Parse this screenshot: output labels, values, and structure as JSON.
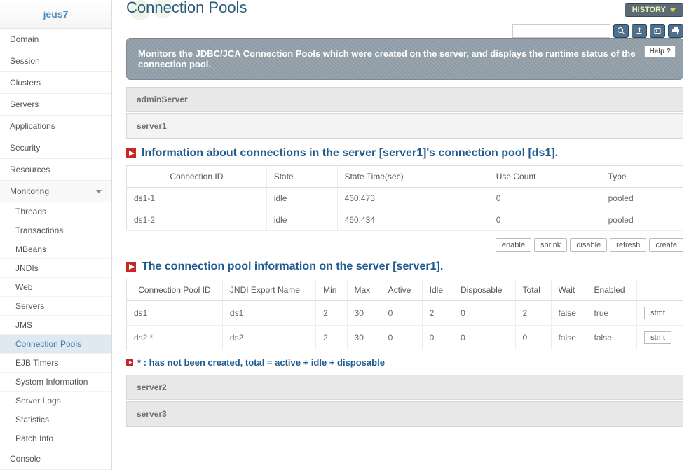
{
  "brand": "jeus7",
  "nav": {
    "items": [
      "Domain",
      "Session",
      "Clusters",
      "Servers",
      "Applications",
      "Security",
      "Resources",
      "Monitoring"
    ],
    "monitoring_children": [
      "Threads",
      "Transactions",
      "MBeans",
      "JNDIs",
      "Web",
      "Servers",
      "JMS",
      "Connection Pools",
      "EJB Timers",
      "System Information",
      "Server Logs",
      "Statistics",
      "Patch Info"
    ],
    "active_child": "Connection Pools",
    "console": "Console"
  },
  "header": {
    "history": "HISTORY",
    "title": "Connection Pools",
    "search_placeholder": "",
    "description": "Monitors the JDBC/JCA Connection Pools which were created on the server, and displays the runtime status of the connection pool.",
    "help": "Help  ?"
  },
  "servers_top": [
    "adminServer",
    "server1"
  ],
  "conn_section": {
    "title": "Information about connections in the server [server1]'s connection pool [ds1].",
    "headers": [
      "Connection ID",
      "State",
      "State Time(sec)",
      "Use Count",
      "Type"
    ],
    "rows": [
      {
        "id": "ds1-1",
        "state": "idle",
        "stateTime": "460.473",
        "useCount": "0",
        "type": "pooled"
      },
      {
        "id": "ds1-2",
        "state": "idle",
        "stateTime": "460.434",
        "useCount": "0",
        "type": "pooled"
      }
    ]
  },
  "pool_actions": [
    "enable",
    "shrink",
    "disable",
    "refresh",
    "create"
  ],
  "pool_section": {
    "title": "The connection pool information on the server [server1].",
    "headers": [
      "Connection Pool ID",
      "JNDI Export Name",
      "Min",
      "Max",
      "Active",
      "Idle",
      "Disposable",
      "Total",
      "Wait",
      "Enabled",
      ""
    ],
    "rows": [
      {
        "id": "ds1",
        "jndi": "ds1",
        "min": "2",
        "max": "30",
        "active": "0",
        "idle": "2",
        "disposable": "0",
        "total": "2",
        "wait": "false",
        "enabled": "true",
        "btn": "stmt"
      },
      {
        "id": "ds2 *",
        "jndi": "ds2",
        "min": "2",
        "max": "30",
        "active": "0",
        "idle": "0",
        "disposable": "0",
        "total": "0",
        "wait": "false",
        "enabled": "false",
        "btn": "stmt"
      }
    ]
  },
  "footnote": "* : has not been created, total = active + idle + disposable",
  "servers_bottom": [
    "server2",
    "server3"
  ]
}
